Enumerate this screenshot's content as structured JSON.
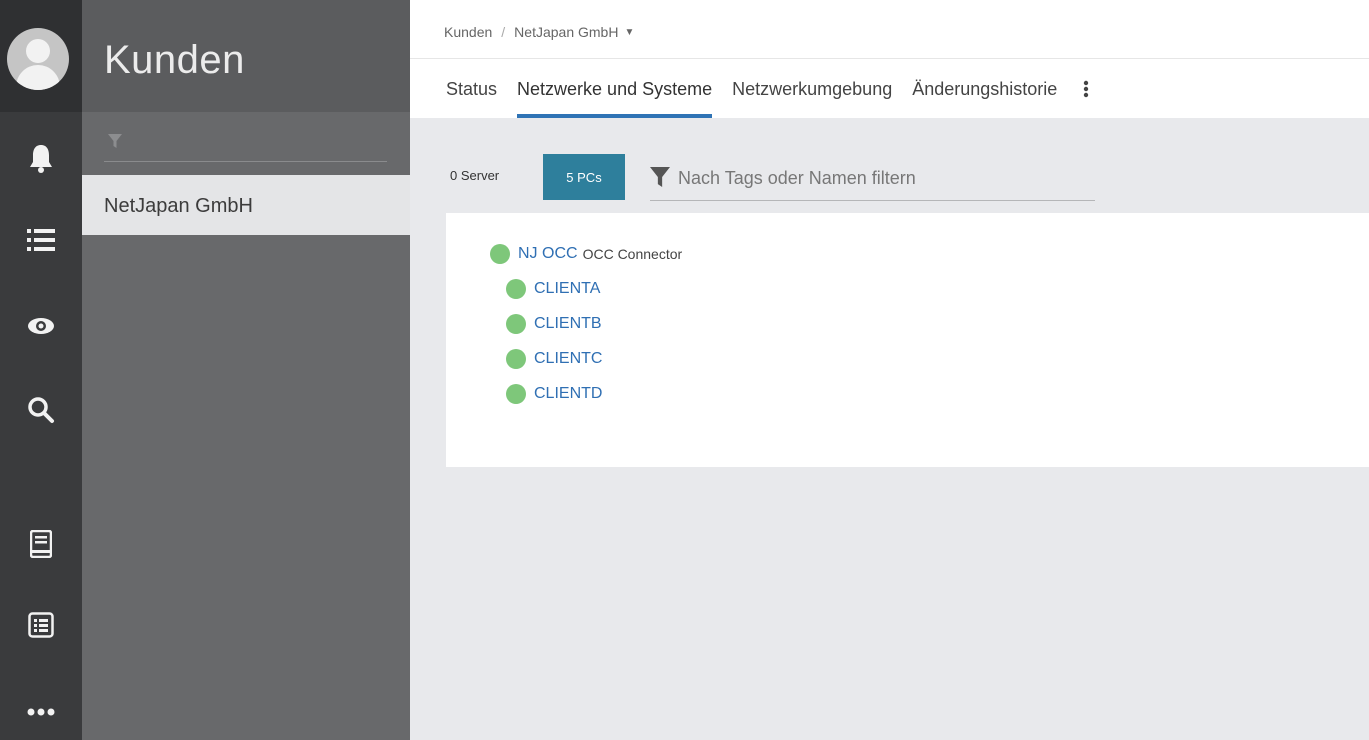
{
  "app": {
    "section_title": "Kunden"
  },
  "rail": {
    "icons": [
      "bell-icon",
      "list-icon",
      "eye-icon",
      "search-icon",
      "book-icon",
      "list-box-icon",
      "more-dots-icon"
    ]
  },
  "sidebar": {
    "filter_placeholder": "",
    "items": [
      {
        "label": "NetJapan GmbH",
        "selected": true
      }
    ]
  },
  "breadcrumb": {
    "root": "Kunden",
    "separator": "/",
    "current": "NetJapan GmbH"
  },
  "tabs": [
    {
      "label": "Status",
      "active": false
    },
    {
      "label": "Netzwerke und Systeme",
      "active": true
    },
    {
      "label": "Netzwerkumgebung",
      "active": false
    },
    {
      "label": "Änderungshistorie",
      "active": false
    }
  ],
  "toolbar": {
    "server_label": "0 Server",
    "pc_label": "5 PCs",
    "filter_placeholder": "Nach Tags oder Namen filtern"
  },
  "tree": {
    "root": {
      "name": "NJ OCC",
      "type": "OCC Connector",
      "status": "online"
    },
    "children": [
      {
        "name": "CLIENTA",
        "status": "online"
      },
      {
        "name": "CLIENTB",
        "status": "online"
      },
      {
        "name": "CLIENTC",
        "status": "online"
      },
      {
        "name": "CLIENTD",
        "status": "online"
      }
    ]
  },
  "colors": {
    "accent": "#2f73b5",
    "pc_button": "#2e7f9c",
    "status_online": "#7ec77a",
    "link": "#2f6fb3"
  }
}
